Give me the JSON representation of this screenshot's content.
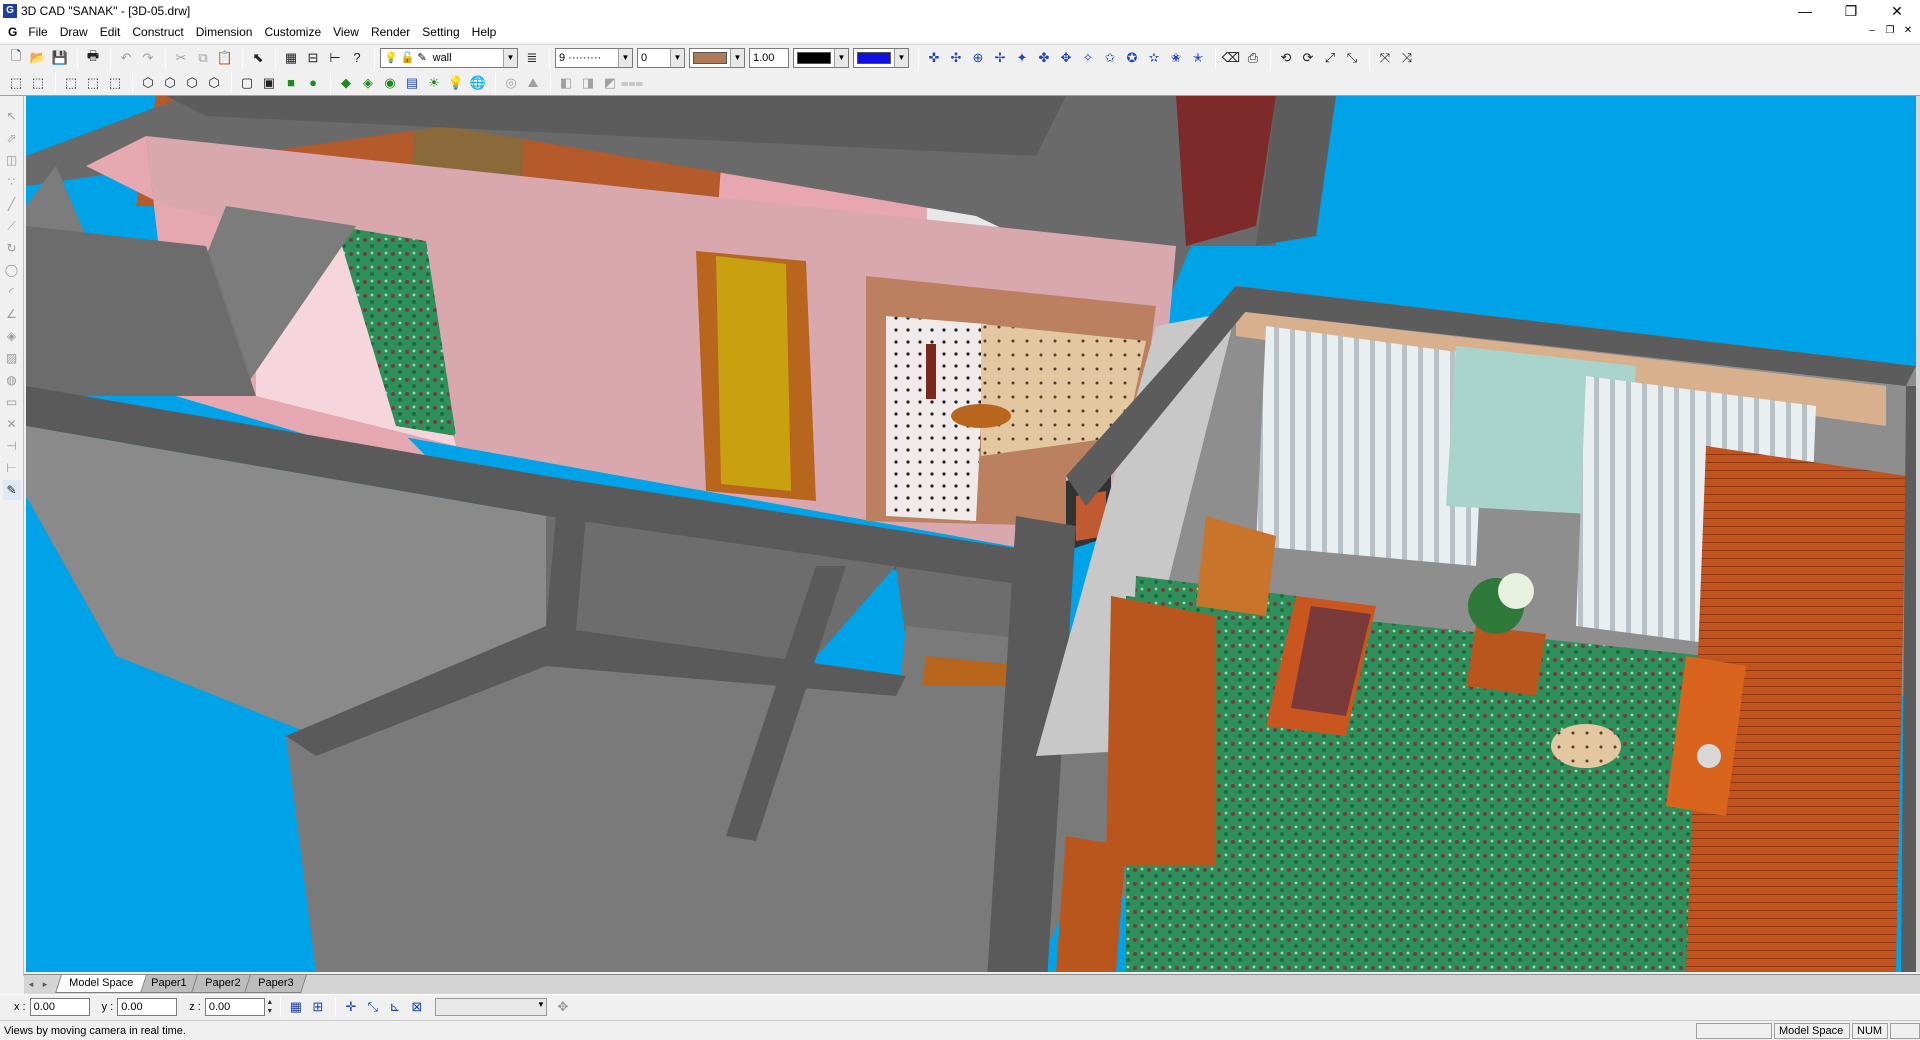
{
  "window": {
    "title": "3D CAD \"SANAK\" - [3D-05.drw]",
    "app_icon": "G",
    "minimize": "—",
    "restore": "❐",
    "close": "✕"
  },
  "menu": {
    "doc_icon": "G",
    "items": [
      "File",
      "Draw",
      "Edit",
      "Construct",
      "Dimension",
      "Customize",
      "View",
      "Render",
      "Setting",
      "Help"
    ]
  },
  "toolbar": {
    "layer_name": "wall",
    "linetype": "9 ·········",
    "lineweight": "0",
    "scale": "1.00",
    "material_color": "#b07a56",
    "line_color": "#000000",
    "fill_color": "#1010e0"
  },
  "tabs": {
    "items": [
      "Model Space",
      "Paper1",
      "Paper2",
      "Paper3"
    ],
    "active": "Model Space"
  },
  "coords": {
    "x_label": "x :",
    "y_label": "y :",
    "z_label": "z :",
    "x": "0.00",
    "y": "0.00",
    "z": "0.00"
  },
  "status": {
    "message": "Views by moving camera in real time.",
    "space": "Model Space",
    "num": "NUM"
  },
  "colors": {
    "viewport_bg": "#00a2e8",
    "wall_top": "#5c5c5c",
    "wall_side": "#8a8a8a",
    "pink_wall": "#d8a8ae",
    "carpet": "#2f8f5a",
    "wood": "#c2521e"
  }
}
